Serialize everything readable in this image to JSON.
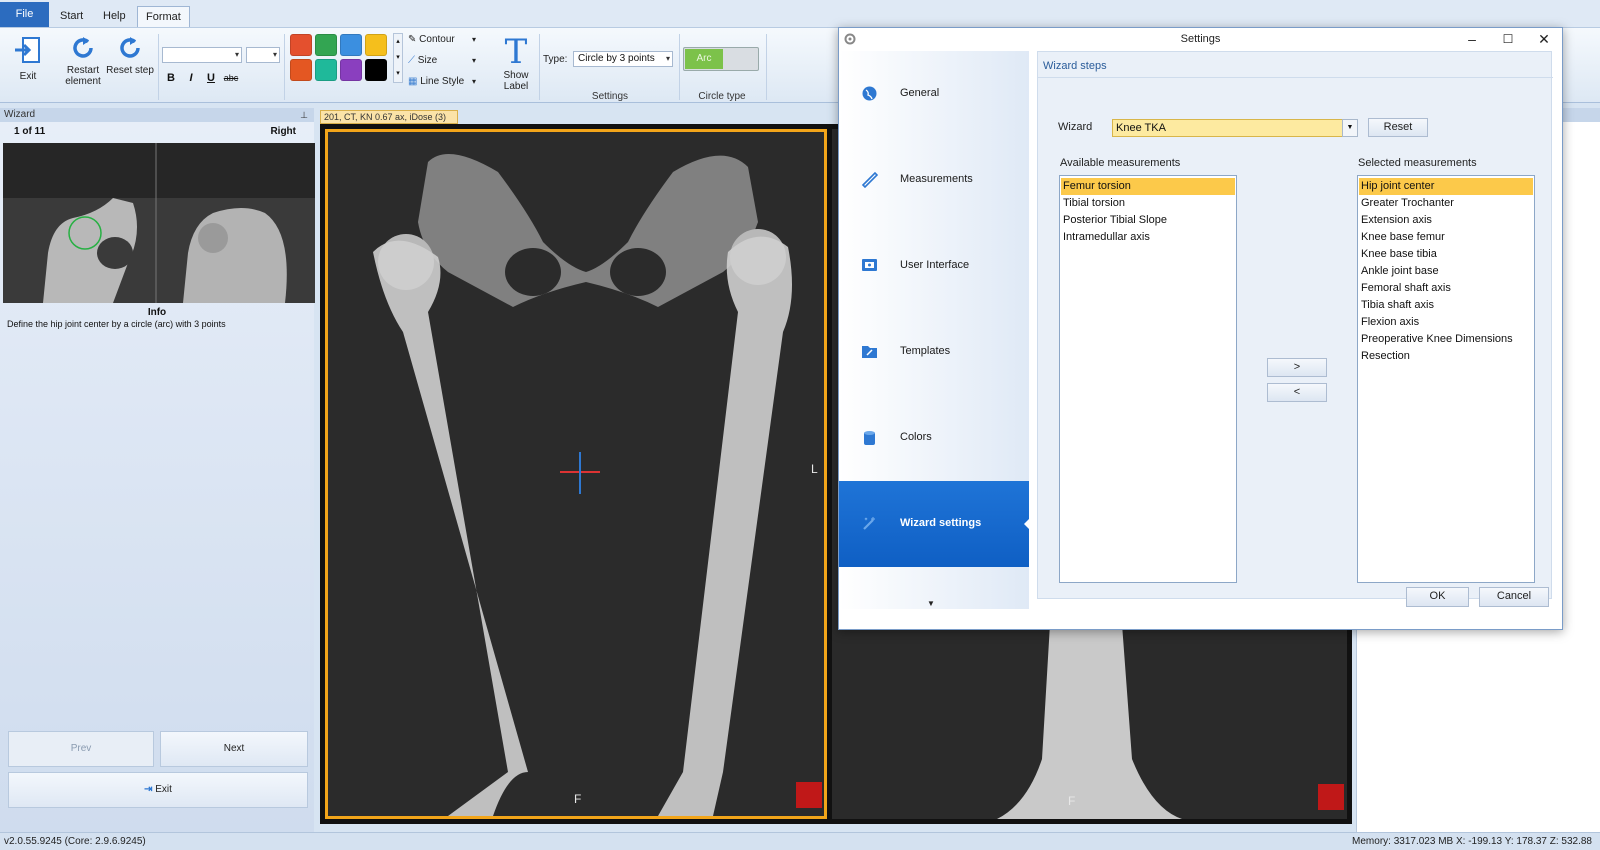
{
  "ribbon": {
    "tabs": [
      {
        "label": "File"
      },
      {
        "label": "Start"
      },
      {
        "label": "Help"
      },
      {
        "label": "Format"
      }
    ],
    "exit_label": "Exit",
    "restart_label_1": "Restart",
    "restart_label_2": "element",
    "reset_step_label": "Reset step",
    "bold": "B",
    "italic": "I",
    "underline": "U",
    "strike": "abc",
    "swatches": [
      "#e4502e",
      "#33a552",
      "#3b8fe0",
      "#f5bf1c",
      "#e45722",
      "#1fb99a",
      "#8a3fbf",
      "#000000"
    ],
    "contour_label": "Contour",
    "size_label": "Size",
    "line_style_label": "Line Style",
    "show_label_1": "Show",
    "show_label_2": "Label",
    "type_label": "Type:",
    "type_value": "Circle by 3 points",
    "settings_group": "Settings",
    "arc_label": "Arc",
    "circle_type_group": "Circle type"
  },
  "wizard": {
    "header": "Wizard",
    "step": "1 of 11",
    "side": "Right",
    "info_title": "Info",
    "info_text": "Define the hip joint center by a circle (arc) with 3 points",
    "prev": "Prev",
    "next": "Next",
    "exit": "Exit"
  },
  "viewer": {
    "tab_label": "201, CT, KN 0.67 ax, iDose (3)",
    "orient_f": "F",
    "orient_l": "L"
  },
  "status": {
    "version": "v2.0.55.9245 (Core: 2.9.6.9245)",
    "metrics": "Memory: 3317.023 MB   X: -199.13   Y: 178.37   Z: 532.88"
  },
  "dialog": {
    "title": "Settings",
    "nav": [
      {
        "label": "General",
        "icon": "globe-icon"
      },
      {
        "label": "Measurements",
        "icon": "ruler-icon"
      },
      {
        "label": "User Interface",
        "icon": "monitor-icon"
      },
      {
        "label": "Templates",
        "icon": "folder-icon"
      },
      {
        "label": "Colors",
        "icon": "paint-bucket-icon"
      },
      {
        "label": "Wizard settings",
        "icon": "wand-icon"
      }
    ],
    "section_title": "Wizard steps",
    "wizard_label": "Wizard",
    "wizard_value": "Knee TKA",
    "reset": "Reset",
    "available_label": "Available measurements",
    "selected_label": "Selected measurements",
    "available": [
      "Femur torsion",
      "Tibial torsion",
      "Posterior Tibial Slope",
      "Intramedullar axis"
    ],
    "selected": [
      "Hip joint center",
      "Greater Trochanter",
      "Extension axis",
      "Knee base femur",
      "Knee base tibia",
      "Ankle joint base",
      "Femoral shaft axis",
      "Tibia shaft axis",
      "Flexion axis",
      "Preoperative Knee Dimensions",
      "Resection"
    ],
    "add": ">",
    "remove": "<",
    "ok": "OK",
    "cancel": "Cancel"
  }
}
